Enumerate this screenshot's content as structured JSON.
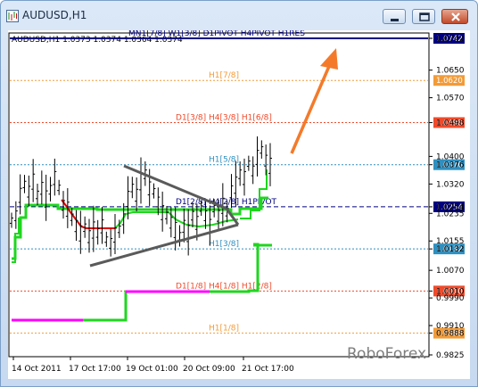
{
  "window": {
    "title": "AUDUSD,H1",
    "icon": "chart-window-icon",
    "buttons": {
      "minimize": "minimize-icon",
      "maximize": "maximize-icon",
      "close": "close-icon"
    }
  },
  "chart": {
    "header": "AUDUSD,H1  1.0373 1.0374 1.0364 1.0374",
    "watermark": "RoboForex",
    "price_axis": [
      "1.0742",
      "1.0650",
      "1.0570",
      "1.0498",
      "1.0400",
      "1.0376",
      "1.0320",
      "1.0254",
      "1.0235",
      "1.0155",
      "1.0132",
      "1.0070",
      "1.0010",
      "0.9990",
      "0.9910",
      "0.9888",
      "0.9825"
    ],
    "time_axis": [
      "14 Oct 2011",
      "17 Oct 17:00",
      "19 Oct 01:00",
      "20 Oct 09:00",
      "21 Oct 17:00"
    ],
    "levels": [
      {
        "label": "MN1[7/8] W1[3/8] D1PIVOT H4PIVOT H1RES",
        "price": "1.0742",
        "color": "#000080",
        "style": "solid"
      },
      {
        "label": "H1[7/8]",
        "price": "1.0620",
        "color": "#f29b38",
        "style": "dotted"
      },
      {
        "label": "D1[3/8] H4[3/8] H1[6/8]",
        "price": "1.0498",
        "color": "#ef4a2a",
        "style": "dotted"
      },
      {
        "label": "H1[5/8]",
        "price": "1.0376",
        "color": "#2f8fbf",
        "style": "dotted"
      },
      {
        "label": "D1[2/8] H4[2/8] H1PIVOT",
        "price": "1.0254",
        "color": "#000080",
        "style": "dashed"
      },
      {
        "label": "H1[3/8]",
        "price": "1.0132",
        "color": "#2f8fbf",
        "style": "dotted"
      },
      {
        "label": "D1[1/8] H4[1/8] H1[2/8]",
        "price": "1.0010",
        "color": "#ef4a2a",
        "style": "dotted"
      },
      {
        "label": "H1[1/8]",
        "price": "0.9888",
        "color": "#f29b38",
        "style": "dotted"
      }
    ],
    "colors": {
      "bars": "#000000",
      "trend_green": "#1fd61f",
      "trend_red": "#e00000",
      "magenta": "#ff00ff",
      "triangle": "#555555",
      "arrow": "#f47a2a"
    }
  }
}
